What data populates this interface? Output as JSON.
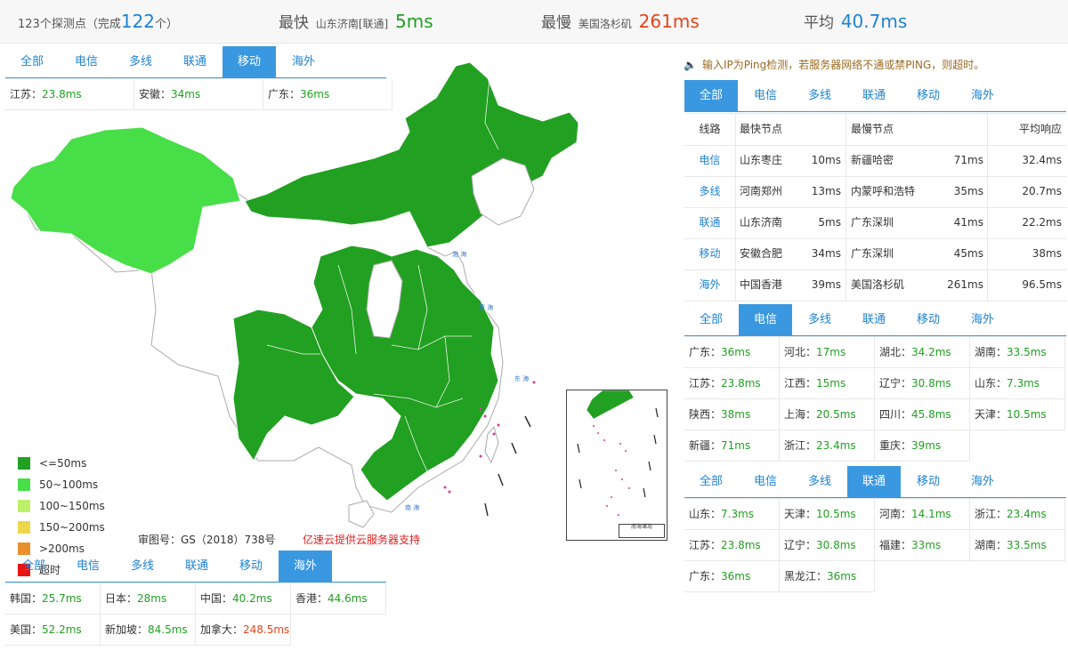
{
  "summary": {
    "total_prefix": "123个探测点（完成",
    "total_done": "122",
    "total_suffix": "个）",
    "fastest_label": "最快",
    "fastest_node": "山东济南[联通]",
    "fastest_value": "5ms",
    "slowest_label": "最慢",
    "slowest_node": "美国洛杉矶",
    "slowest_value": "261ms",
    "average_label": "平均",
    "average_value": "40.7ms"
  },
  "tab_labels": [
    "全部",
    "电信",
    "多线",
    "联通",
    "移动",
    "海外"
  ],
  "left_top": {
    "active_tab": 4,
    "cells": [
      {
        "region": "江苏：",
        "value": "23.8ms"
      },
      {
        "region": "安徽：",
        "value": "34ms"
      },
      {
        "region": "广东：",
        "value": "36ms"
      }
    ]
  },
  "map": {
    "legend": [
      {
        "label": "<=50ms",
        "color": "#22a022"
      },
      {
        "label": "50~100ms",
        "color": "#48de48"
      },
      {
        "label": "100~150ms",
        "color": "#bdf06a"
      },
      {
        "label": "150~200ms",
        "color": "#ecd84a"
      },
      {
        "label": ">200ms",
        "color": "#e8902e"
      },
      {
        "label": "超时",
        "color": "#e81212"
      }
    ],
    "approval_no": "审图号：GS（2018）738号",
    "sponsor": "亿速云提供云服务器支持",
    "inset_scale": "南海诸岛"
  },
  "left_bottom": {
    "active_tab": 5,
    "cells": [
      {
        "region": "韩国：",
        "value": "25.7ms"
      },
      {
        "region": "日本：",
        "value": "28ms"
      },
      {
        "region": "中国：",
        "value": "40.2ms"
      },
      {
        "region": "香港：",
        "value": "44.6ms"
      },
      {
        "region": "美国：",
        "value": "52.2ms"
      },
      {
        "region": "新加坡：",
        "value": "84.5ms"
      },
      {
        "region": "加拿大：",
        "value": "248.5ms",
        "slow": true
      }
    ]
  },
  "right": {
    "notice": "输入IP为Ping检测，若服务器网络不通或禁PING，则超时。",
    "overview": {
      "active_tab": 0,
      "headers": [
        "线路",
        "最快节点",
        "最慢节点",
        "平均响应"
      ],
      "rows": [
        {
          "line": "电信",
          "fast_node": "山东枣庄",
          "fast_value": "10ms",
          "slow_node": "新疆哈密",
          "slow_value": "71ms",
          "avg": "32.4ms"
        },
        {
          "line": "多线",
          "fast_node": "河南郑州",
          "fast_value": "13ms",
          "slow_node": "内蒙呼和浩特",
          "slow_value": "35ms",
          "avg": "20.7ms"
        },
        {
          "line": "联通",
          "fast_node": "山东济南",
          "fast_value": "5ms",
          "slow_node": "广东深圳",
          "slow_value": "41ms",
          "avg": "22.2ms"
        },
        {
          "line": "移动",
          "fast_node": "安徽合肥",
          "fast_value": "34ms",
          "slow_node": "广东深圳",
          "slow_value": "45ms",
          "avg": "38ms"
        },
        {
          "line": "海外",
          "fast_node": "中国香港",
          "fast_value": "39ms",
          "slow_node": "美国洛杉矶",
          "slow_value": "261ms",
          "avg": "96.5ms"
        }
      ]
    },
    "telecom": {
      "active_tab": 1,
      "cells": [
        {
          "region": "广东：",
          "value": "36ms"
        },
        {
          "region": "河北：",
          "value": "17ms"
        },
        {
          "region": "湖北：",
          "value": "34.2ms"
        },
        {
          "region": "湖南：",
          "value": "33.5ms"
        },
        {
          "region": "江苏：",
          "value": "23.8ms"
        },
        {
          "region": "江西：",
          "value": "15ms"
        },
        {
          "region": "辽宁：",
          "value": "30.8ms"
        },
        {
          "region": "山东：",
          "value": "7.3ms"
        },
        {
          "region": "陕西：",
          "value": "38ms"
        },
        {
          "region": "上海：",
          "value": "20.5ms"
        },
        {
          "region": "四川：",
          "value": "45.8ms"
        },
        {
          "region": "天津：",
          "value": "10.5ms"
        },
        {
          "region": "新疆：",
          "value": "71ms"
        },
        {
          "region": "浙江：",
          "value": "23.4ms"
        },
        {
          "region": "重庆：",
          "value": "39ms"
        }
      ]
    },
    "unicom": {
      "active_tab": 3,
      "cells": [
        {
          "region": "山东：",
          "value": "7.3ms"
        },
        {
          "region": "天津：",
          "value": "10.5ms"
        },
        {
          "region": "河南：",
          "value": "14.1ms"
        },
        {
          "region": "浙江：",
          "value": "23.4ms"
        },
        {
          "region": "江苏：",
          "value": "23.8ms"
        },
        {
          "region": "辽宁：",
          "value": "30.8ms"
        },
        {
          "region": "福建：",
          "value": "33ms"
        },
        {
          "region": "湖南：",
          "value": "33.5ms"
        },
        {
          "region": "广东：",
          "value": "36ms"
        },
        {
          "region": "黑龙江：",
          "value": "36ms"
        }
      ]
    }
  }
}
